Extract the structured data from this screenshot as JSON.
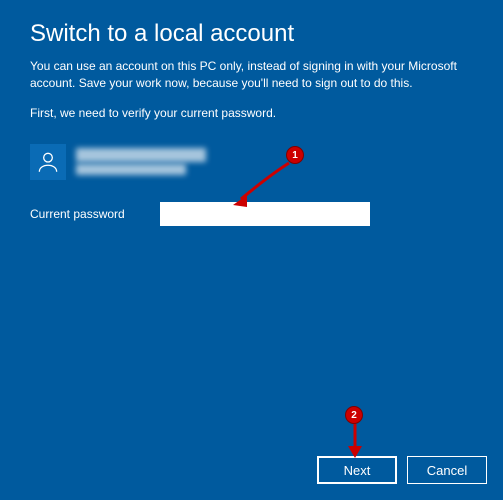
{
  "title": "Switch to a local account",
  "description": "You can use an account on this PC only, instead of signing in with your Microsoft account. Save your work now, because you'll need to sign out to do this.",
  "verify_text": "First, we need to verify your current password.",
  "user": {
    "display_name": "",
    "email": ""
  },
  "field": {
    "label": "Current password",
    "value": ""
  },
  "buttons": {
    "next": "Next",
    "cancel": "Cancel"
  },
  "annotations": {
    "1": "1",
    "2": "2"
  }
}
